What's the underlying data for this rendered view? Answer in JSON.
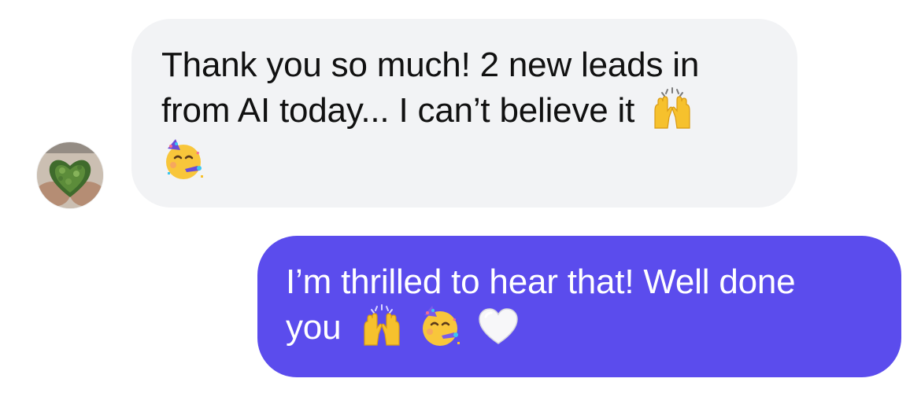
{
  "conversation": {
    "incoming": {
      "line1": "Thank you so much! 2 new leads in",
      "line2": "from AI today... I can’t believe it",
      "emojis_line2": [
        "raising-hands-icon"
      ],
      "emojis_line3": [
        "partying-face-icon"
      ]
    },
    "outgoing": {
      "line1": "I’m thrilled to hear that! Well done",
      "line2": "you",
      "emojis_line2": [
        "raising-hands-icon",
        "partying-face-icon",
        "white-heart-icon"
      ]
    }
  },
  "colors": {
    "incoming_bubble": "#f2f3f5",
    "outgoing_bubble": "#5b4ced",
    "incoming_text": "#111111",
    "outgoing_text": "#ffffff"
  }
}
